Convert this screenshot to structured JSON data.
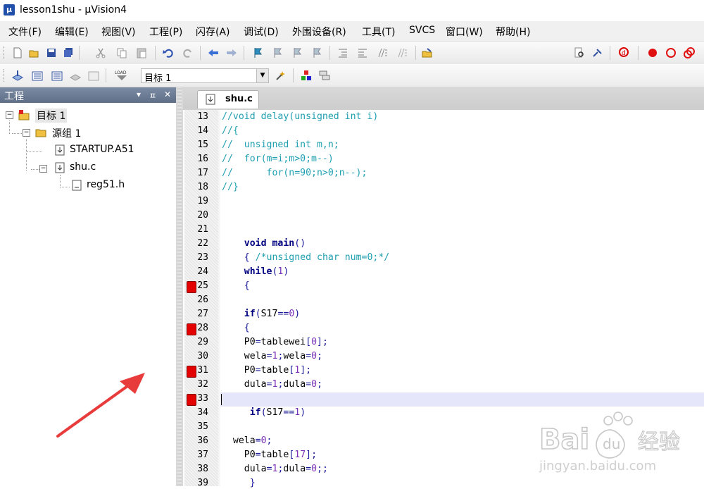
{
  "window": {
    "title": "lesson1shu - µVision4"
  },
  "menu": [
    "文件(F)",
    "编辑(E)",
    "视图(V)",
    "工程(P)",
    "闪存(A)",
    "调试(D)",
    "外围设备(R)",
    "工具(T)",
    "SVCS",
    "窗口(W)",
    "帮助(H)"
  ],
  "toolbar2": {
    "target_select": "目标 1",
    "load_label": "LOAD"
  },
  "project_panel": {
    "title": "工程",
    "tree": {
      "target": "目标 1",
      "group": "源组 1",
      "file1": "STARTUP.A51",
      "file2": "shu.c",
      "include": "reg51.h"
    }
  },
  "editor": {
    "tab": "shu.c",
    "lines": [
      {
        "n": "13",
        "t": "//void delay(unsigned int i)"
      },
      {
        "n": "14",
        "t": "//{"
      },
      {
        "n": "15",
        "t": "//  unsigned int m,n;"
      },
      {
        "n": "16",
        "t": "//  for(m=i;m>0;m--)"
      },
      {
        "n": "17",
        "t": "//      for(n=90;n>0;n--);"
      },
      {
        "n": "18",
        "t": "//}"
      },
      {
        "n": "19",
        "t": ""
      },
      {
        "n": "20",
        "t": ""
      },
      {
        "n": "21",
        "t": ""
      },
      {
        "n": "22",
        "t": "    void main()"
      },
      {
        "n": "23",
        "t": "    { /*unsigned char num=0;*/"
      },
      {
        "n": "24",
        "t": "    while(1)"
      },
      {
        "n": "25",
        "t": "    {"
      },
      {
        "n": "26",
        "t": ""
      },
      {
        "n": "27",
        "t": "    if(S17==0)"
      },
      {
        "n": "28",
        "t": "    {"
      },
      {
        "n": "29",
        "t": "    P0=tablewei[0];"
      },
      {
        "n": "30",
        "t": "    wela=1;wela=0;"
      },
      {
        "n": "31",
        "t": "    P0=table[1];"
      },
      {
        "n": "32",
        "t": "    dula=1;dula=0;"
      },
      {
        "n": "33",
        "t": ""
      },
      {
        "n": "34",
        "t": "     if(S17==1)"
      },
      {
        "n": "35",
        "t": ""
      },
      {
        "n": "36",
        "t": "  wela=0;"
      },
      {
        "n": "37",
        "t": "    P0=table[17];"
      },
      {
        "n": "38",
        "t": "    dula=1;dula=0;;"
      },
      {
        "n": "39",
        "t": "     }"
      }
    ],
    "breakpoint_lines": [
      "25",
      "28",
      "31",
      "33"
    ],
    "current_line": "33"
  },
  "watermark": {
    "brand": "Bai",
    "brand2": "经验",
    "url": "jingyan.baidu.com"
  },
  "colors": {
    "comment": "#1e9fb1",
    "keyword": "#000080",
    "number": "#7a2fb5",
    "breakpoint": "#e30000",
    "arrow": "#e83b3b"
  }
}
